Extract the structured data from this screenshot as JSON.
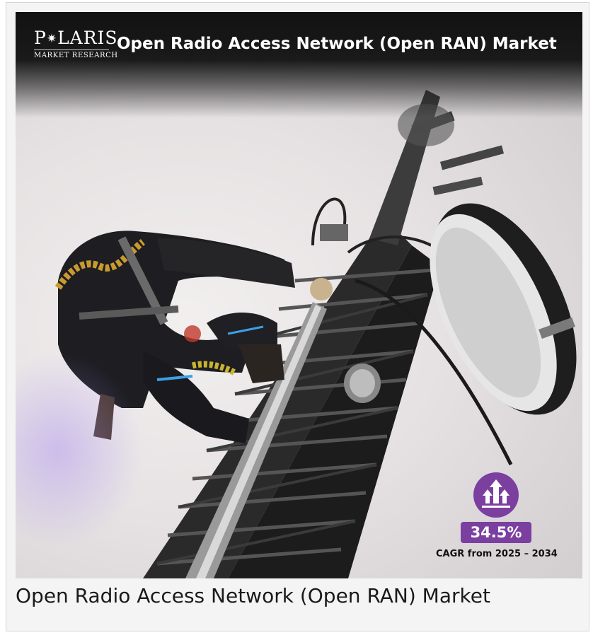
{
  "banner": {
    "logo_name_a": "P",
    "logo_name_b": "LARIS",
    "logo_subtitle": "MARKET RESEARCH",
    "title": "Open Radio Access Network (Open RAN) Market"
  },
  "stat": {
    "value": "34.5%",
    "label": "CAGR from 2025 – 2034",
    "icon": "growth-arrows-icon"
  },
  "caption": "Open Radio Access Network (Open RAN) Market",
  "colors": {
    "accent_purple": "#7b3fa0",
    "banner_dark": "#121212",
    "caption_text": "#1a1a1a"
  }
}
